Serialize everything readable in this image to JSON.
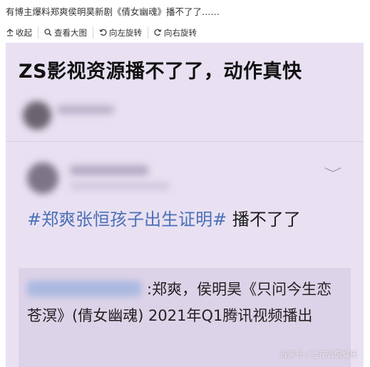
{
  "window": {
    "title": "有博主爆料郑爽侯明昊新剧《倩女幽魂》播不了了……"
  },
  "toolbar": {
    "collapse_label": "收起",
    "view_large_label": "查看大图",
    "rotate_left_label": "向左旋转",
    "rotate_right_label": "向右旋转"
  },
  "image": {
    "headline": "ZS影视资源播不了了，动作真快",
    "post_hashtag": "#郑爽张恒孩子出生证明#",
    "post_text": " 播不了了",
    "quote_text": ":郑爽，侯明昊《只问今生恋苍溟》(倩女幽魂) 2021年Q1腾讯视频播出",
    "watermark": "百家号 / 雪花调侃娱乐"
  },
  "icons": {
    "collapse": "collapse-up-icon",
    "view_large": "magnifier-icon",
    "rotate_left": "rotate-left-icon",
    "rotate_right": "rotate-right-icon",
    "expand": "chevron-down-icon"
  },
  "colors": {
    "hashtag": "#4b6fb7",
    "image_background": "#e9e1f2"
  }
}
